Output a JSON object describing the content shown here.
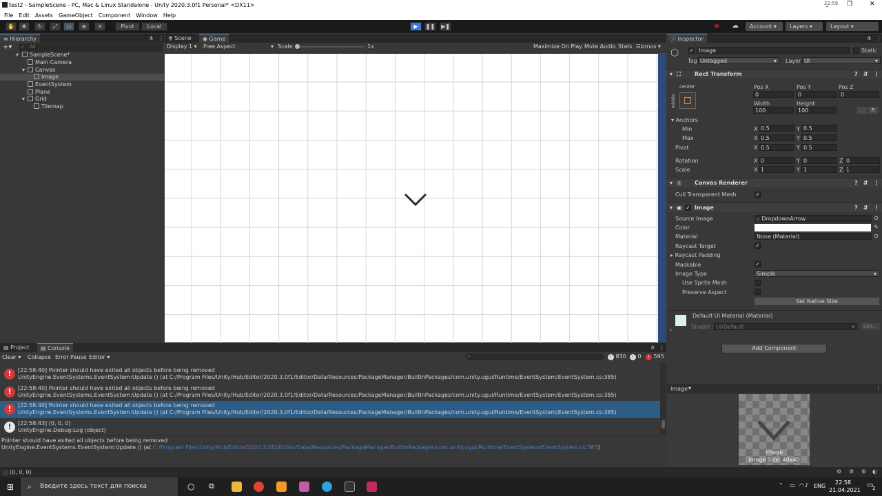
{
  "window": {
    "title": "test2 - SampleScene - PC, Mac & Linux Standalone - Unity 2020.3.0f1 Personal* <DX11>"
  },
  "menu": [
    "File",
    "Edit",
    "Assets",
    "GameObject",
    "Component",
    "Window",
    "Help"
  ],
  "toolbar": {
    "pivot": "Pivot",
    "local": "Local",
    "account": "Account",
    "layers": "Layers",
    "layout": "Layout"
  },
  "hierarchy": {
    "tab": "Hierarchy",
    "search_placeholder": "All",
    "items": [
      {
        "label": "SampleScene*"
      },
      {
        "label": "Main Camera"
      },
      {
        "label": "Canvas"
      },
      {
        "label": "Image"
      },
      {
        "label": "EventSystem"
      },
      {
        "label": "Plane"
      },
      {
        "label": "Grid"
      },
      {
        "label": "Tilemap"
      }
    ]
  },
  "game": {
    "tabs": [
      "Scene",
      "Game"
    ],
    "display": "Display 1",
    "aspect": "Free Aspect",
    "scale_label": "Scale",
    "scale_value": "1x",
    "options": [
      "Maximize On Play",
      "Mute Audio",
      "Stats",
      "Gizmos"
    ]
  },
  "inspector": {
    "tab": "Inspector",
    "object_name": "Image",
    "static_label": "Static",
    "tag_label": "Tag",
    "tag_value": "Untagged",
    "layer_label": "Layer",
    "layer_value": "UI",
    "rect": {
      "title": "Rect Transform",
      "anchor_h": "center",
      "anchor_v": "middle",
      "pos_x_label": "Pos X",
      "pos_x": "0",
      "pos_y_label": "Pos Y",
      "pos_y": "0",
      "pos_z_label": "Pos Z",
      "pos_z": "0",
      "width_label": "Width",
      "width": "100",
      "height_label": "Height",
      "height": "100",
      "anchors_label": "Anchors",
      "min_label": "Min",
      "min_x": "0.5",
      "min_y": "0.5",
      "max_label": "Max",
      "max_x": "0.5",
      "max_y": "0.5",
      "pivot_label": "Pivot",
      "pivot_x": "0.5",
      "pivot_y": "0.5",
      "rotation_label": "Rotation",
      "rot_x": "0",
      "rot_y": "0",
      "rot_z": "0",
      "scale_label": "Scale",
      "scale_x": "1",
      "scale_y": "1",
      "scale_z": "1"
    },
    "canvas_renderer": {
      "title": "Canvas Renderer",
      "cull_label": "Cull Transparent Mesh"
    },
    "image": {
      "title": "Image",
      "source_label": "Source Image",
      "source_value": "DropdownArrow",
      "color_label": "Color",
      "material_label": "Material",
      "material_value": "None (Material)",
      "raycast_target_label": "Raycast Target",
      "raycast_padding_label": "Raycast Padding",
      "maskable_label": "Maskable",
      "image_type_label": "Image Type",
      "image_type_value": "Simple",
      "use_sprite_mesh_label": "Use Sprite Mesh",
      "preserve_aspect_label": "Preserve Aspect",
      "set_native_size": "Set Native Size"
    },
    "material": {
      "name": "Default UI Material (Material)",
      "shader_label": "Shader",
      "shader_value": "UI/Default",
      "edit": "Edit..."
    },
    "add_component": "Add Component",
    "preview_title": "Image",
    "preview_caption": "Image",
    "preview_size": "Image Size: 40x40"
  },
  "console": {
    "tabs": [
      "Project",
      "Console"
    ],
    "clear": "Clear",
    "collapse": "Collapse",
    "error_pause": "Error Pause",
    "editor": "Editor",
    "info_count": "830",
    "warn_count": "0",
    "error_count": "595",
    "rows": [
      {
        "line1": "[22:58:40] Pointer should have exited all objects before being removed",
        "line2": "UnityEngine.EventSystems.EventSystem:Update () (at C:/Program Files/Unity/Hub/Editor/2020.3.0f1/Editor/Data/Resources/PackageManager/BuiltInPackages/com.unity.ugui/Runtime/EventSystem/EventSystem.cs:385)"
      },
      {
        "line1": "[22:58:40] Pointer should have exited all objects before being removed",
        "line2": "UnityEngine.EventSystems.EventSystem:Update () (at C:/Program Files/Unity/Hub/Editor/2020.3.0f1/Editor/Data/Resources/PackageManager/BuiltInPackages/com.unity.ugui/Runtime/EventSystem/EventSystem.cs:385)"
      },
      {
        "line1": "[22:58:40] Pointer should have exited all objects before being removed",
        "line2": "UnityEngine.EventSystems.EventSystem:Update () (at C:/Program Files/Unity/Hub/Editor/2020.3.0f1/Editor/Data/Resources/PackageManager/BuiltInPackages/com.unity.ugui/Runtime/EventSystem/EventSystem.cs:385)"
      },
      {
        "line1": "[22:58:43] (0, 0, 0)",
        "line2": "UnityEngine.Debug:Log (object)"
      }
    ],
    "detail_line1": "Pointer should have exited all objects before being removed",
    "detail_line2_prefix": "UnityEngine.EventSystems.EventSystem:Update () (at ",
    "detail_link": "C:/Program Files/Unity/Hub/Editor/2020.3.0f1/Editor/Data/Resources/PackageManager/BuiltInPackages/com.unity.ugui/Runtime/EventSystem/EventSystem.cs:385",
    "detail_line2_suffix": ")"
  },
  "status": {
    "text": "(0, 0, 0)"
  },
  "taskbar": {
    "search_placeholder": "Введите здесь текст для поиска",
    "lang": "ENG",
    "time": "22:58",
    "date": "21.04.2021",
    "notif": "2",
    "clock_top": "22:59"
  },
  "colors": {
    "accent": "#3a79d8",
    "selection": "#2c5d87",
    "error": "#d13b3b"
  }
}
